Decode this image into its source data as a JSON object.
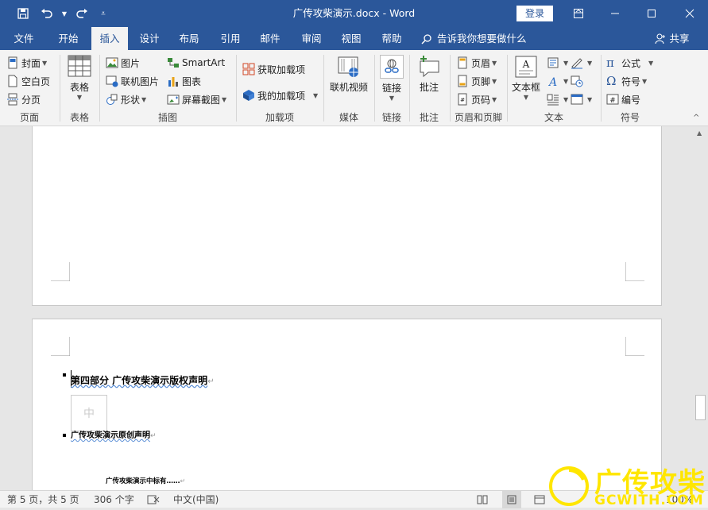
{
  "titlebar": {
    "doc_title": "广传攻柴演示.docx  -  Word",
    "login_label": "登录"
  },
  "tabs": [
    {
      "label": "文件"
    },
    {
      "label": "开始"
    },
    {
      "label": "插入"
    },
    {
      "label": "设计"
    },
    {
      "label": "布局"
    },
    {
      "label": "引用"
    },
    {
      "label": "邮件"
    },
    {
      "label": "审阅"
    },
    {
      "label": "视图"
    },
    {
      "label": "帮助"
    }
  ],
  "tellme": "告诉我你想要做什么",
  "share_label": "共享",
  "ribbon": {
    "pages": {
      "label": "页面",
      "cover": "封面",
      "blank": "空白页",
      "break": "分页"
    },
    "tables": {
      "label": "表格",
      "table": "表格"
    },
    "illustrations": {
      "label": "插图",
      "picture": "图片",
      "online_picture": "联机图片",
      "shapes": "形状",
      "smartart": "SmartArt",
      "chart": "图表",
      "screenshot": "屏幕截图"
    },
    "addins": {
      "label": "加载项",
      "get": "获取加载项",
      "mine": "我的加载项"
    },
    "media": {
      "label": "媒体",
      "video": "联机视频"
    },
    "links": {
      "label": "链接",
      "link": "链接"
    },
    "comments": {
      "label": "批注",
      "comment": "批注"
    },
    "header_footer": {
      "label": "页眉和页脚",
      "header": "页眉",
      "footer": "页脚",
      "page_number": "页码"
    },
    "text": {
      "label": "文本",
      "textbox": "文本框"
    },
    "symbols": {
      "label": "符号",
      "equation": "公式",
      "symbol": "符号",
      "number": "编号"
    }
  },
  "document": {
    "heading": "第四部分  广传攻柴演示版权声明",
    "image_char": "中",
    "subheading": "广传攻柴演示原创声明",
    "small_line": "广传攻柴演示中标有……"
  },
  "status": {
    "page": "第 5 页，共 5 页",
    "words": "306 个字",
    "lang": "中文(中国)",
    "zoom": "100%"
  },
  "watermark": {
    "line1": "广传攻柴",
    "line2": "GCWITH.COM"
  }
}
